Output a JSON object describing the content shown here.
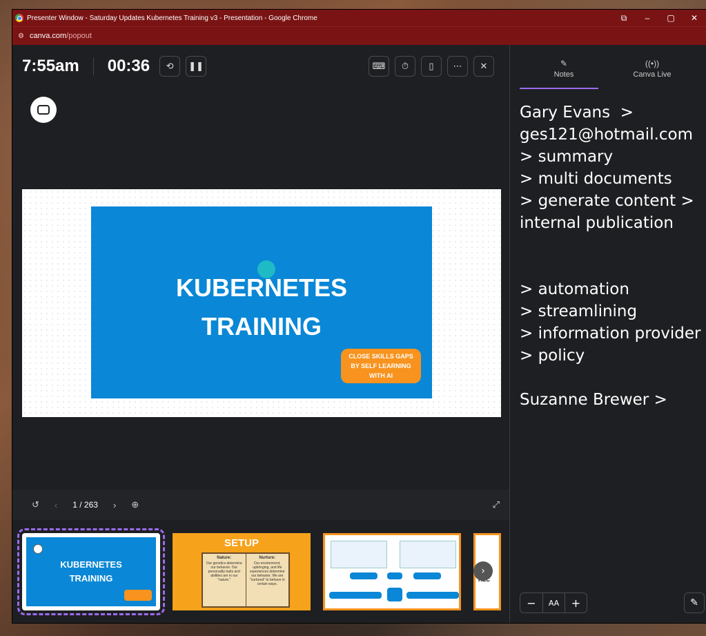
{
  "browser": {
    "window_title": "Presenter Window - Saturday Updates Kubernetes Training v3 - Presentation - Google Chrome",
    "url_domain": "canva.com",
    "url_path": "/popout",
    "controls": [
      "⧉",
      "–",
      "▢",
      "✕"
    ]
  },
  "presenter": {
    "clock": "7:55am",
    "timer": "00:36"
  },
  "slide": {
    "title_line1": "KUBERNETES",
    "title_line2": "TRAINING",
    "badge": "CLOSE SKILLS GAPS BY SELF LEARNING WITH AI"
  },
  "navigation": {
    "page_indicator": "1 / 263"
  },
  "thumbnails": [
    {
      "title_line1": "KUBERNETES",
      "title_line2": "TRAINING"
    },
    {
      "title": "SETUP",
      "left_heading": "Nature:",
      "left_text": "Our genetics determine our behavior. Our personality traits and abilities are in our \"nature.\"",
      "right_heading": "Nurture:",
      "right_text": "Our environment, upbringing, and life experiences determine our behavior. We are \"nurtured\" to behave in certain ways."
    },
    {},
    {
      "label": "REC"
    }
  ],
  "sidebar": {
    "tabs": [
      {
        "label": "Notes",
        "icon": "notes-icon"
      },
      {
        "label": "Canva Live",
        "icon": "broadcast-icon"
      }
    ],
    "notes_text": "Gary Evans  >\nges121@hotmail.com\n> summary\n> multi documents\n> generate content >\ninternal publication\n\n\n> automation\n> streamlining\n> information provider\n> policy\n\nSuzanne Brewer >",
    "font_controls": {
      "decrease": "−",
      "label": "AA",
      "increase": "+"
    }
  }
}
